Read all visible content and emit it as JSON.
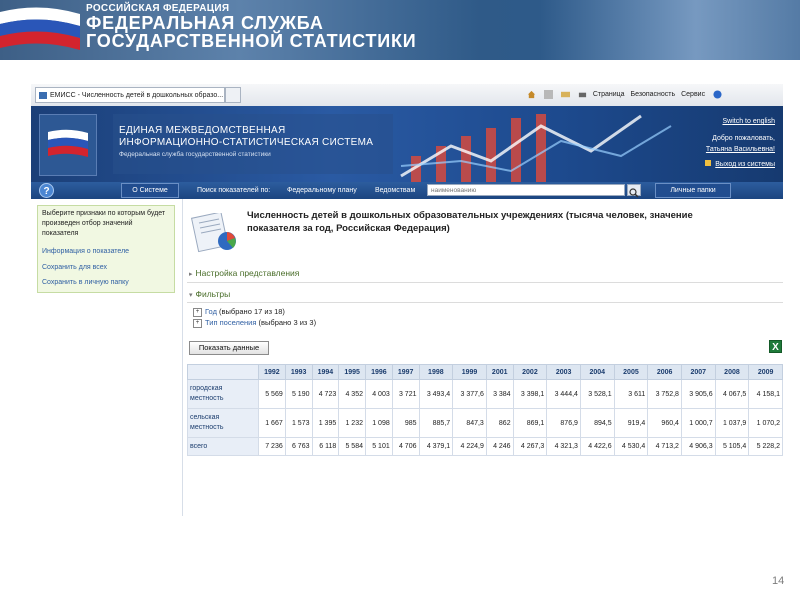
{
  "slide_banner": {
    "line1": "РОССИЙСКАЯ ФЕДЕРАЦИЯ",
    "line2": "ФЕДЕРАЛЬНАЯ СЛУЖБА",
    "line3": "ГОСУДАРСТВЕННОЙ СТАТИСТИКИ"
  },
  "browser": {
    "tab_title": "ЕМИСС - Численность детей в дошкольных образо...",
    "commands": [
      "Страница",
      "Безопасность",
      "Сервис"
    ]
  },
  "site_header": {
    "title_line1": "ЕДИНАЯ МЕЖВЕДОМСТВЕННАЯ",
    "title_line2": "ИНФОРМАЦИОННО-СТАТИСТИЧЕСКАЯ СИСТЕМА",
    "subtitle": "Федеральная служба государственной статистики",
    "switch_lang": "Switch to english",
    "welcome": "Добро пожаловать,",
    "user_name": "Татьяна Васильевна!",
    "logout": "Выход из системы"
  },
  "navbar": {
    "help": "?",
    "about": "О Системе",
    "search_label": "Поиск показателей по:",
    "federal_plan": "Федеральному плану",
    "agencies": "Ведомствам",
    "search_placeholder": "наименованию",
    "personal": "Личные папки"
  },
  "left_panel": {
    "hint": "Выберите признаки по которым будет произведен отбор значений показателя",
    "links": [
      "Информация о показателе",
      "Сохранить для всех",
      "Сохранить в личную папку"
    ]
  },
  "indicator": {
    "title": "Численность детей в дошкольных образовательных учреждениях (тысяча человек, значение показателя за год, Российская Федерация)",
    "presentation_settings": "Настройка представления",
    "filters": "Фильтры",
    "filter_year_label": "Год",
    "filter_year_value": "(выбрано 17 из 18)",
    "filter_type_label": "Тип поселения",
    "filter_type_value": "(выбрано 3 из 3)",
    "show_data_button": "Показать данные"
  },
  "table": {
    "years": [
      "1992",
      "1993",
      "1994",
      "1995",
      "1996",
      "1997",
      "1998",
      "1999",
      "2001",
      "2002",
      "2003",
      "2004",
      "2005",
      "2006",
      "2007",
      "2008",
      "2009"
    ],
    "rows": [
      {
        "label_a": "городская",
        "label_b": "местность",
        "values": [
          "5 569",
          "5 190",
          "4 723",
          "4 352",
          "4 003",
          "3 721",
          "3 493,4",
          "3 377,6",
          "3 384",
          "3 398,1",
          "3 444,4",
          "3 528,1",
          "3 611",
          "3 752,8",
          "3 905,6",
          "4 067,5",
          "4 158,1"
        ]
      },
      {
        "label_a": "сельская",
        "label_b": "местность",
        "values": [
          "1 667",
          "1 573",
          "1 395",
          "1 232",
          "1 098",
          "985",
          "885,7",
          "847,3",
          "862",
          "869,1",
          "876,9",
          "894,5",
          "919,4",
          "960,4",
          "1 000,7",
          "1 037,9",
          "1 070,2"
        ]
      },
      {
        "label_a": "всего",
        "label_b": "",
        "values": [
          "7 236",
          "6 763",
          "6 118",
          "5 584",
          "5 101",
          "4 706",
          "4 379,1",
          "4 224,9",
          "4 246",
          "4 267,3",
          "4 321,3",
          "4 422,6",
          "4 530,4",
          "4 713,2",
          "4 906,3",
          "5 105,4",
          "5 228,2"
        ]
      }
    ]
  },
  "page_number": "14"
}
